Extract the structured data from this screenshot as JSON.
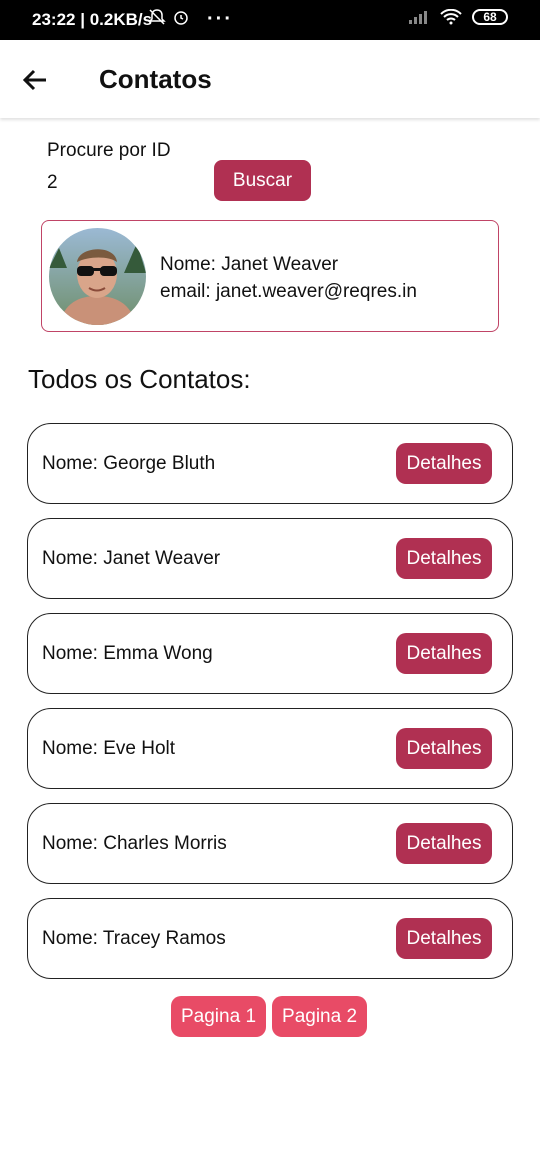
{
  "status_bar": {
    "time": "23:22",
    "network_speed": "0.2KB/s",
    "battery": "68"
  },
  "header": {
    "title": "Contatos"
  },
  "search": {
    "label": "Procure por ID",
    "value": "2",
    "button_label": "Buscar"
  },
  "result": {
    "name": "Nome: Janet Weaver",
    "email": "email: janet.weaver@reqres.in"
  },
  "list": {
    "title": "Todos os Contatos:",
    "button_label": "Detalhes",
    "items": [
      {
        "name": "Nome: George Bluth"
      },
      {
        "name": "Nome: Janet Weaver"
      },
      {
        "name": "Nome: Emma Wong"
      },
      {
        "name": "Nome: Eve Holt"
      },
      {
        "name": "Nome: Charles Morris"
      },
      {
        "name": "Nome: Tracey Ramos"
      }
    ]
  },
  "pagination": {
    "page1": "Pagina 1",
    "page2": "Pagina 2"
  },
  "colors": {
    "primary_button": "#b03052",
    "pager_button": "#e84b66",
    "card_border": "#c04466"
  },
  "icons": [
    "back-arrow-icon",
    "bell-off-icon",
    "alarm-icon",
    "signal-icon",
    "wifi-icon",
    "battery-icon",
    "avatar-photo"
  ]
}
